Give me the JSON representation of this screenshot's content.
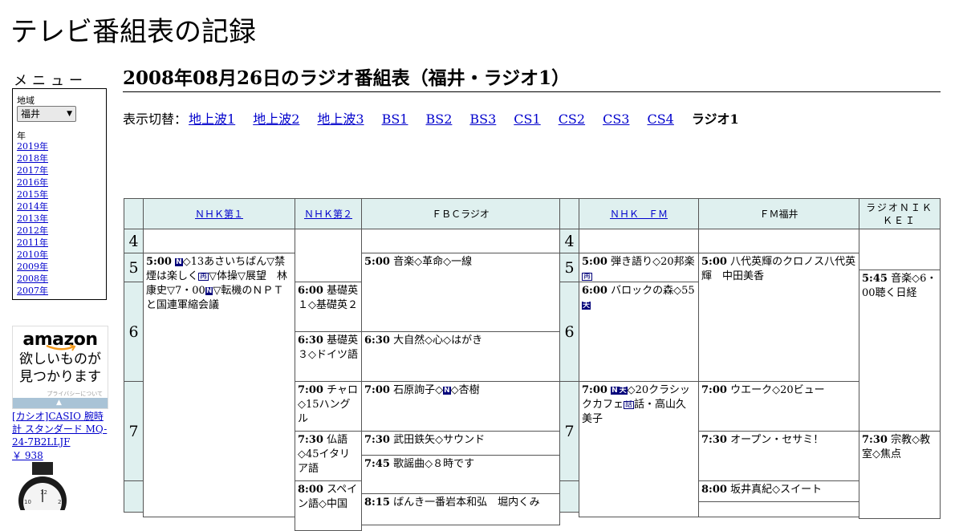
{
  "site_title": "テレビ番組表の記録",
  "menu": {
    "heading": "メニュー",
    "region_label": "地域",
    "region_value": "福井",
    "year_label": "年",
    "years": [
      "2019年",
      "2018年",
      "2017年",
      "2016年",
      "2015年",
      "2014年",
      "2013年",
      "2012年",
      "2011年",
      "2010年",
      "2009年",
      "2008年",
      "2007年"
    ]
  },
  "ad": {
    "brand": "amazon",
    "copy_line1": "欲しいものが",
    "copy_line2": "見つかります",
    "privacy": "プライバシーについて",
    "product": "[カシオ]CASIO 腕時計 スタンダード MQ-24-7B2LLJF",
    "price": "￥ 938"
  },
  "page_heading": "2008年08月26日のラジオ番組表（福井・ラジオ1）",
  "switcher": {
    "label": "表示切替：",
    "links": [
      "地上波1",
      "地上波2",
      "地上波3",
      "BS1",
      "BS2",
      "BS3",
      "CS1",
      "CS2",
      "CS3",
      "CS4"
    ],
    "current": "ラジオ1"
  },
  "channels": [
    {
      "name": "ＮＨＫ第１",
      "link": true
    },
    {
      "name": "ＮＨＫ第２",
      "link": true
    },
    {
      "name": "ＦＢＣラジオ",
      "link": false
    },
    {
      "name": "ＮＨＫ　ＦＭ",
      "link": true
    },
    {
      "name": "ＦＭ福井",
      "link": false
    },
    {
      "name": "ラジオＮＩＫＫＥＩ",
      "link": false
    }
  ],
  "hours": [
    "4",
    "5",
    "6",
    "7"
  ],
  "programs": {
    "nhk1_500": {
      "time": "5:00",
      "text_a": "◇13あさいちばん▽禁煙は楽しく",
      "text_b": "▽体操▽展望　林康史▽7・00",
      "text_c": "▽転機のＮＰＴと国連軍縮会議"
    },
    "nhk2_600": {
      "time": "6:00",
      "text": "基礎英１◇基礎英２"
    },
    "nhk2_630": {
      "time": "6:30",
      "text": "基礎英３◇ドイツ語"
    },
    "nhk2_700": {
      "time": "7:00",
      "text": "チャロ◇15ハングル"
    },
    "nhk2_730": {
      "time": "7:30",
      "text": "仏語◇45イタリア語"
    },
    "nhk2_800": {
      "time": "8:00",
      "text": "スペイン語◇中国"
    },
    "fbc_500": {
      "time": "5:00",
      "text": "音楽◇革命◇一線"
    },
    "fbc_630": {
      "time": "6:30",
      "text": "大自然◇心◇はがき"
    },
    "fbc_700": {
      "time": "7:00",
      "text_a": "石原詢子◇",
      "text_b": "◇杏樹"
    },
    "fbc_730": {
      "time": "7:30",
      "text": "武田鉄矢◇サウンド"
    },
    "fbc_745": {
      "time": "7:45",
      "text": "歌謡曲◇８時です"
    },
    "fbc_815": {
      "time": "8:15",
      "text": "ばんき一番岩本和弘　堀内くみ"
    },
    "nhkfm_500": {
      "time": "5:00",
      "text": "弾き語り◇20邦楽"
    },
    "nhkfm_600": {
      "time": "6:00",
      "text": "バロックの森◇55"
    },
    "nhkfm_700": {
      "time": "7:00",
      "text_a": "◇20クラシックカフェ",
      "text_b": "話・高山久美子"
    },
    "fmf_500": {
      "time": "5:00",
      "text": "八代英輝のクロノス八代英輝　中田美香"
    },
    "fmf_700": {
      "time": "7:00",
      "text": "ウエーク◇20ビュー"
    },
    "fmf_730": {
      "time": "7:30",
      "text": "オープン・セサミ！"
    },
    "fmf_800": {
      "time": "8:00",
      "text": "坂井真紀◇スイート"
    },
    "nikkei_545": {
      "time": "5:45",
      "text": "音楽◇6・00聴く日経"
    },
    "nikkei_730": {
      "time": "7:30",
      "text": "宗教◇教室◇焦点"
    }
  },
  "badges": {
    "news": "N",
    "rebroadcast": "再",
    "weather": "天",
    "talk": "話"
  }
}
